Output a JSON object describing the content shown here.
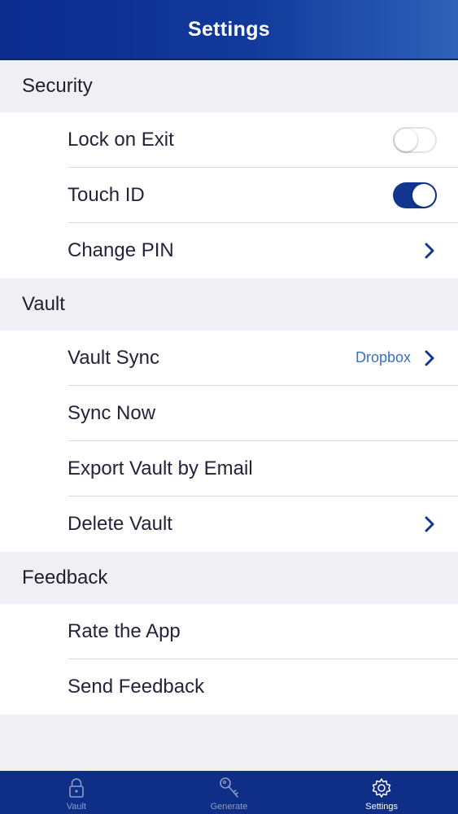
{
  "header": {
    "title": "Settings"
  },
  "sections": [
    {
      "title": "Security",
      "rows": [
        {
          "label": "Lock on Exit",
          "control": "toggle",
          "value": false
        },
        {
          "label": "Touch ID",
          "control": "toggle",
          "value": true
        },
        {
          "label": "Change PIN",
          "control": "chevron"
        }
      ]
    },
    {
      "title": "Vault",
      "rows": [
        {
          "label": "Vault Sync",
          "control": "chevron",
          "detail": "Dropbox"
        },
        {
          "label": "Sync Now"
        },
        {
          "label": "Export Vault by Email"
        },
        {
          "label": "Delete Vault",
          "control": "chevron"
        }
      ]
    },
    {
      "title": "Feedback",
      "rows": [
        {
          "label": "Rate the App"
        },
        {
          "label": "Send Feedback"
        }
      ]
    }
  ],
  "tabs": [
    {
      "label": "Vault",
      "icon": "lock-icon",
      "active": false
    },
    {
      "label": "Generate",
      "icon": "key-icon",
      "active": false
    },
    {
      "label": "Settings",
      "icon": "gear-icon",
      "active": true
    }
  ],
  "colors": {
    "brand": "#123592",
    "accent_text": "#3a6fc4",
    "tab_bar": "#0f2e87"
  }
}
